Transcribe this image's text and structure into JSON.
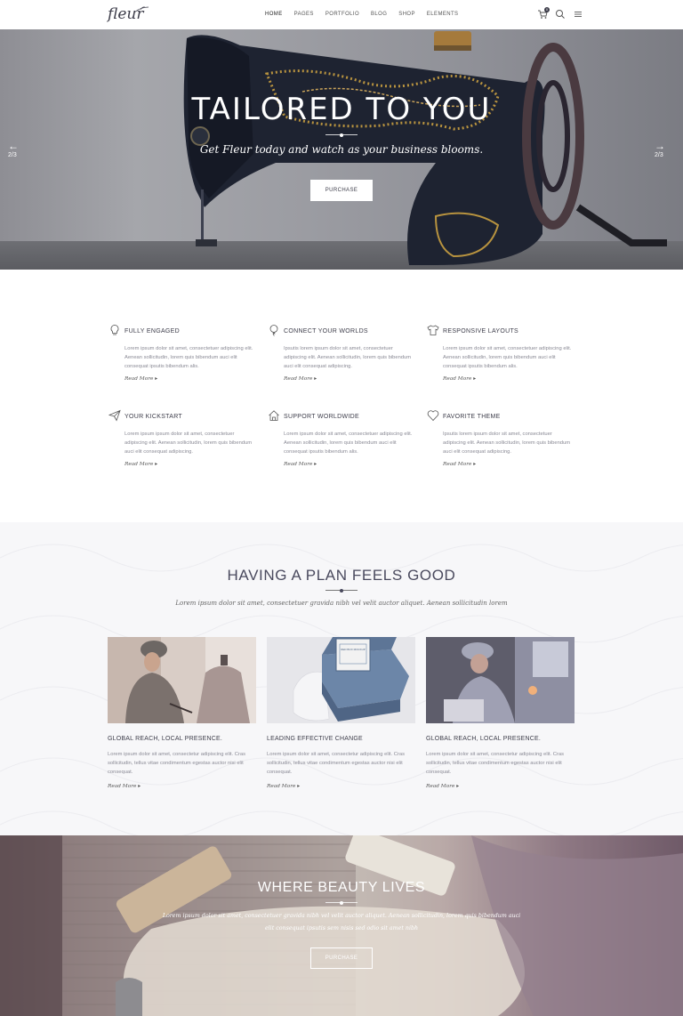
{
  "header": {
    "logo": "fleur",
    "nav": [
      "HOME",
      "PAGES",
      "PORTFOLIO",
      "BLOG",
      "SHOP",
      "ELEMENTS"
    ],
    "cart_count": "0"
  },
  "hero": {
    "title": "TAILORED TO YOU",
    "subtitle": "Get Fleur today and watch as your business blooms.",
    "button": "PURCHASE",
    "prev_arrow": "←",
    "next_arrow": "→",
    "slide_counter": "2/3"
  },
  "features": [
    {
      "title": "FULLY ENGAGED",
      "icon": "lightbulb-icon",
      "text": "Lorem ipsum dolor sit amet, consectetuer adipiscing elit. Aenean sollicitudin, lorem quis bibendum auci elit consequat ipsutis bibendum alis.",
      "more": "Read More"
    },
    {
      "title": "CONNECT YOUR WORLDS",
      "icon": "balloon-icon",
      "text": "Ipsutis lorem ipsum dolor sit amet, consectetuer adipiscing elit. Aenean sollicitudin, lorem quis bibendum auci elit consequat adipiscing.",
      "more": "Read More"
    },
    {
      "title": "RESPONSIVE LAYOUTS",
      "icon": "shirt-icon",
      "text": "Lorem ipsum dolor sit amet, consectetuer adipiscing elit. Aenean sollicitudin, lorem quis bibendum auci elit consequat ipsutis bibendum alis.",
      "more": "Read More"
    },
    {
      "title": "YOUR KICKSTART",
      "icon": "paper-plane-icon",
      "text": "Lorem ipsum ipsum dolor sit amet, consectetuer adipiscing elit. Aenean sollicitudin, lorem quis bibendum auci elit consequat adipiscing.",
      "more": "Read More"
    },
    {
      "title": "SUPPORT WORLDWIDE",
      "icon": "house-icon",
      "text": "Lorem ipsum dolor sit amet, consectetuer adipiscing elit. Aenean sollicitudin, lorem quis bibendum auci elit consequat ipsutis bibendum alis.",
      "more": "Read More"
    },
    {
      "title": "FAVORITE THEME",
      "icon": "heart-icon",
      "text": "Ipsutis lorem ipsum dolor sit amet, consectetuer adipiscing elit. Aenean sollicitudin, lorem quis bibendum auci elit consequat adipiscing.",
      "more": "Read More"
    }
  ],
  "plan": {
    "title": "HAVING A PLAN FEELS GOOD",
    "subtitle": "Lorem ipsum dolor sit amet, consectetuer gravida nibh vel velit auctor aliquet. Aenean sollicitudin lorem",
    "cards": [
      {
        "title": "GLOBAL REACH, LOCAL PRESENCE.",
        "text": "Lorem ipsum dolor sit amet, consectetur adipiscing elit. Cras sollicitudin, tellus vitae condimentum egestas auctor nisi elit consequat.",
        "more": "Read More"
      },
      {
        "title": "LEADING EFFECTIVE CHANGE",
        "text": "Lorem ipsum dolor sit amet, consectetur adipiscing elit. Cras sollicitudin, tellus vitae condimentum egestas auctor nisi elit consequat.",
        "more": "Read More",
        "box_label": "RED BOX MOCKUP"
      },
      {
        "title": "GLOBAL REACH, LOCAL PRESENCE.",
        "text": "Lorem ipsum dolor sit amet, consectetur adipiscing elit. Cras sollicitudin, tellus vitae condimentum egestas auctor nisi elit consequat.",
        "more": "Read More"
      }
    ]
  },
  "beauty": {
    "title": "WHERE BEAUTY LIVES",
    "subtitle": "Lorem ipsum dolor sit amet, consectetuer gravida nibh vel velit auctor aliquet. Aenean sollicitudin, lorem quis bibendum auci elit consequat ipsutis sem nisis sed odio sit amet nibh",
    "button": "PURCHASE"
  }
}
